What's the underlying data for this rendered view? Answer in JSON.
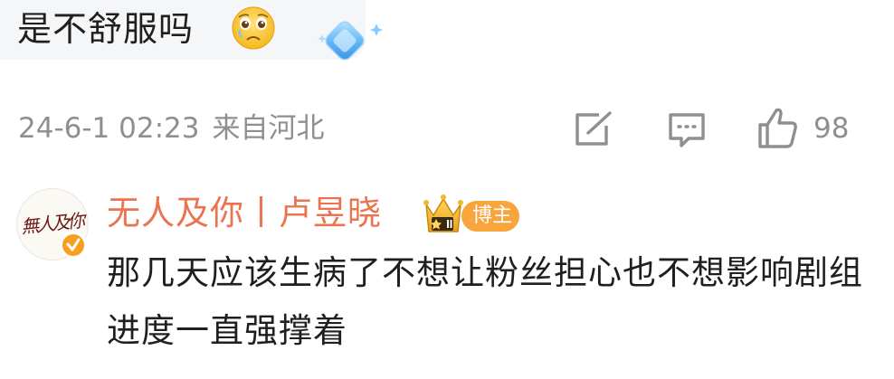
{
  "quoted_comment": {
    "text": "是不舒服吗",
    "emoji": "crying-face-emoji",
    "sticker": "blue-diamond-icon"
  },
  "meta": {
    "date": "24-6-1 02:23",
    "location": "来自河北",
    "like_count": "98"
  },
  "actions": {
    "share_icon": "share-icon",
    "comment_icon": "comment-icon",
    "like_icon": "thumbs-up-icon"
  },
  "reply": {
    "username": "无人及你丨卢昱晓",
    "avatar_text": "無人及你",
    "role_tag": "博主",
    "crown_badge": "crown-icon",
    "text": "那几天应该生病了不想让粉丝担心也不想影响剧组进度一直强撑着"
  },
  "colors": {
    "username": "#eb7350",
    "meta": "#8f8f8f",
    "tag": "#f8a53d",
    "bubble_bg": "#f5f6f8",
    "body_text": "#1f1f1f"
  }
}
